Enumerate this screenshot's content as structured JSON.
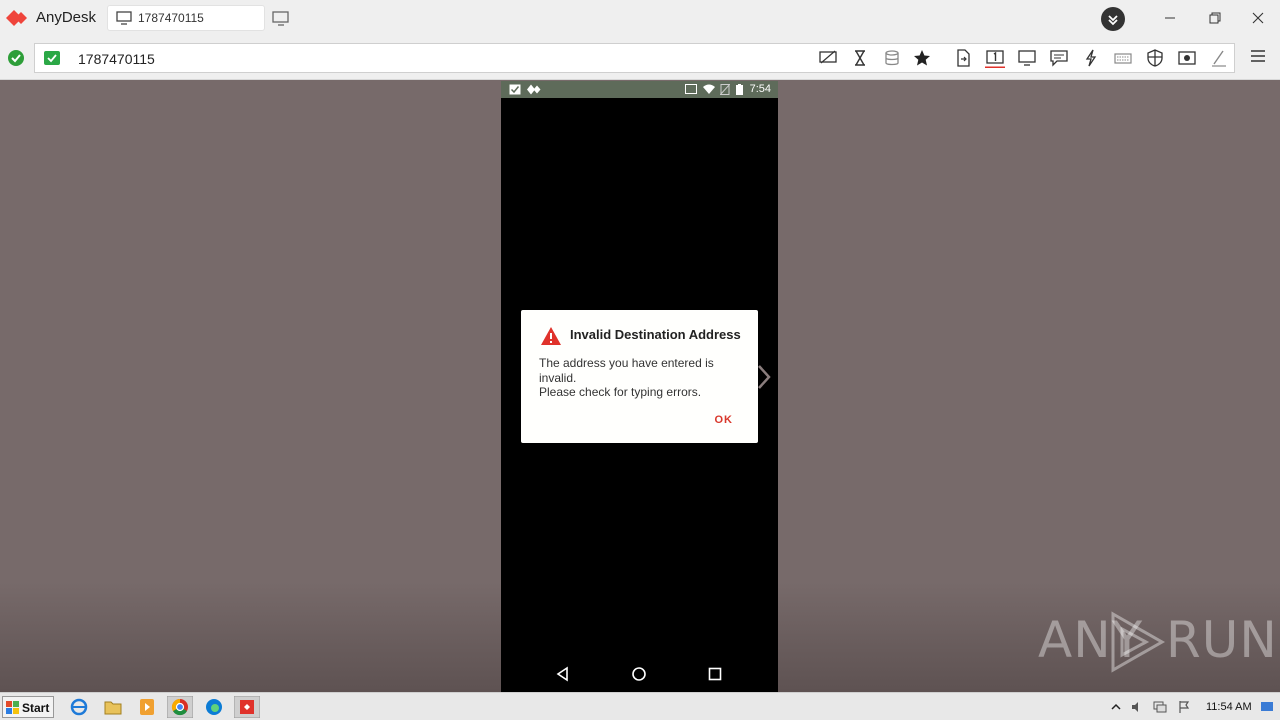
{
  "app": {
    "title": "AnyDesk",
    "tab_label": "1787470115"
  },
  "address": {
    "value": "1787470115"
  },
  "remote": {
    "status_time": "7:54",
    "dialog": {
      "title": "Invalid Destination Address",
      "message_line1": "The address you have entered is invalid.",
      "message_line2": "Please check for typing errors.",
      "ok_label": "OK"
    }
  },
  "watermark": {
    "left": "ANY",
    "right": "RUN"
  },
  "taskbar": {
    "start_label": "Start",
    "clock": "11:54 AM"
  },
  "colors": {
    "accent": "#e0322b",
    "ok_green": "#2e9e39",
    "remote_bg": "#776a6a"
  }
}
